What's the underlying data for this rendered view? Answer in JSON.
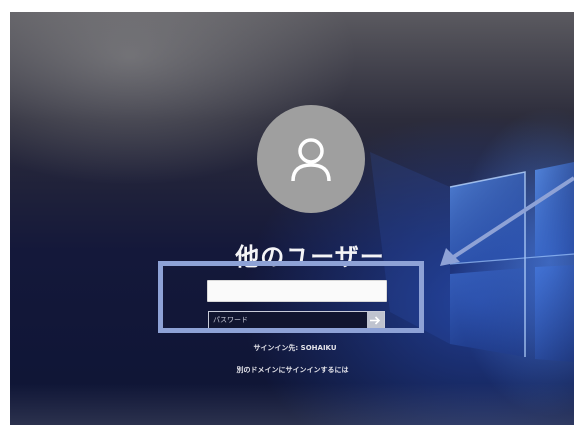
{
  "login": {
    "user_name": "他のユーザー",
    "username_value": "",
    "password_placeholder": "パスワード",
    "sign_in_domain": "サインイン先: SOHAIKU",
    "other_domain_link": "別のドメインにサインインするには"
  },
  "icons": {
    "avatar": "user-silhouette",
    "submit": "right-arrow"
  },
  "colors": {
    "highlight_box": "#8ea2d6",
    "annotation_arrow": "#8ea2d6",
    "avatar_bg": "#9f9f9f"
  }
}
